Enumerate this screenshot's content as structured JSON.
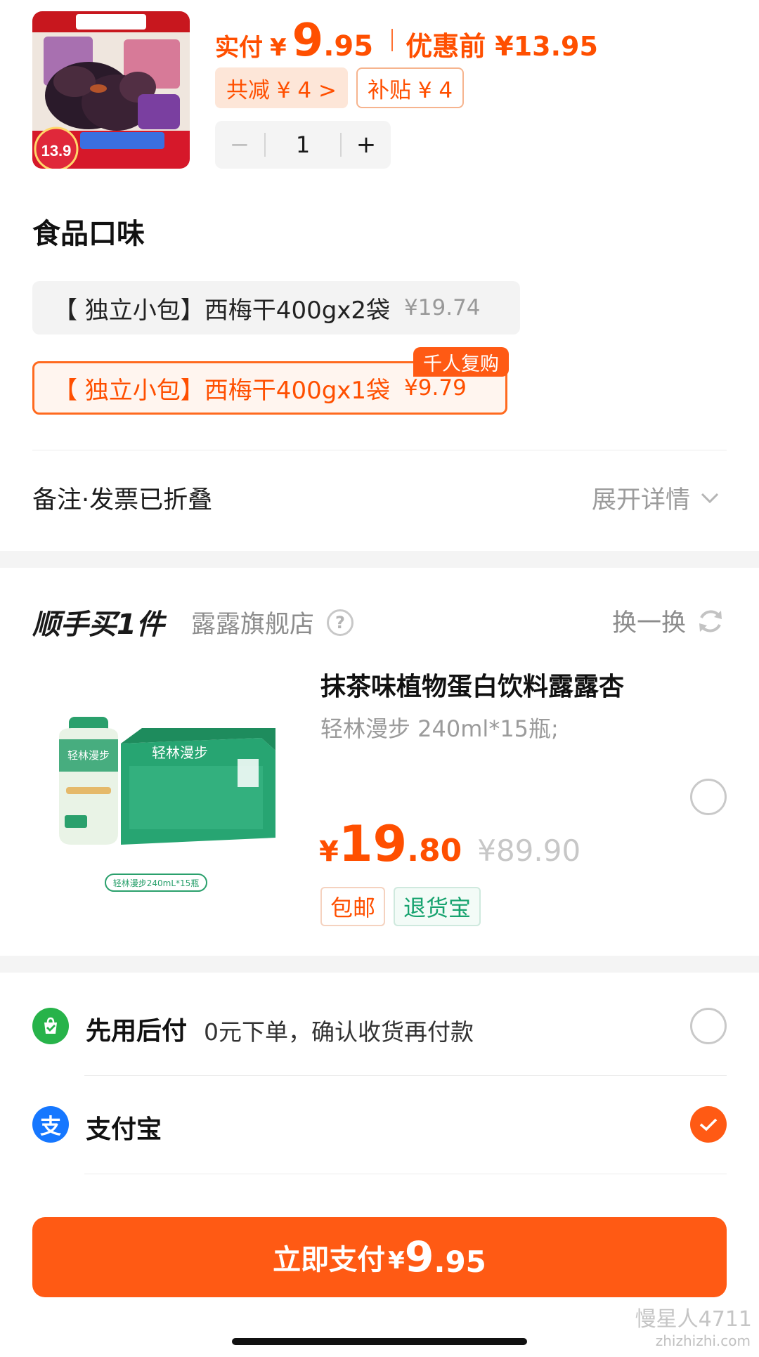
{
  "product": {
    "thumb_alt": "Prunes",
    "paid_label": "实付",
    "yen": "¥",
    "price_int": "9",
    "price_dec": ".95",
    "orig_label": "优惠前 ¥13.95",
    "discount_total": "共减 ¥ 4 >",
    "subsidy": "补贴 ¥ 4",
    "qty": "1",
    "minus": "−",
    "plus": "+"
  },
  "flavor": {
    "title": "食品口味",
    "options": [
      {
        "label": "【 独立小包】西梅干400gx2袋",
        "price": "¥19.74"
      },
      {
        "label": "【 独立小包】西梅干400gx1袋",
        "price": "¥9.79"
      }
    ],
    "badge": "千人复购"
  },
  "remark": {
    "label": "备注·发票已折叠",
    "expand": "展开详情"
  },
  "addon": {
    "title": "顺手买1件",
    "store": "露露旗舰店",
    "help": "?",
    "swap": "换一换",
    "name": "抹茶味植物蛋白饮料露露杏",
    "spec": "轻林漫步 240ml*15瓶;",
    "yen": "¥",
    "price_int": "19",
    "price_dec": ".80",
    "orig": "¥89.90",
    "tag_ship": "包邮",
    "tag_return": "退货宝",
    "img_caption": "轻林漫步240mL*15瓶",
    "brand_text": "轻林漫步"
  },
  "payment": {
    "later_name": "先用后付",
    "later_desc": "0元下单，确认收货再付款",
    "alipay_name": "支付宝"
  },
  "submit": {
    "label": "立即支付",
    "yen": "¥",
    "int": "9",
    "dec": ".95"
  },
  "watermark": {
    "line1": "慢星人4711",
    "line2": "zhizhizhi.com"
  },
  "colors": {
    "accent": "#ff5a14",
    "green": "#27b34a",
    "alipay": "#1677ff"
  }
}
